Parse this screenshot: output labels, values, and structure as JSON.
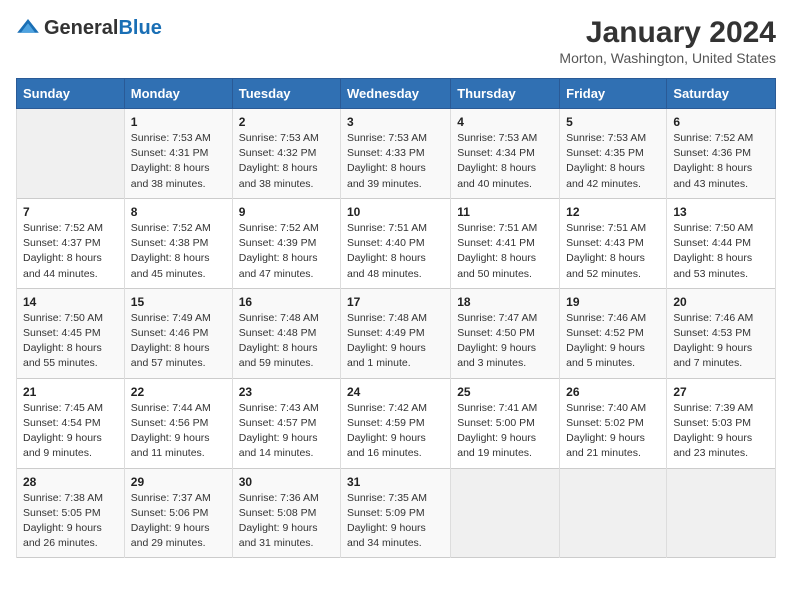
{
  "header": {
    "logo_general": "General",
    "logo_blue": "Blue",
    "month_title": "January 2024",
    "location": "Morton, Washington, United States"
  },
  "days_of_week": [
    "Sunday",
    "Monday",
    "Tuesday",
    "Wednesday",
    "Thursday",
    "Friday",
    "Saturday"
  ],
  "weeks": [
    [
      {
        "day": "",
        "info": ""
      },
      {
        "day": "1",
        "info": "Sunrise: 7:53 AM\nSunset: 4:31 PM\nDaylight: 8 hours\nand 38 minutes."
      },
      {
        "day": "2",
        "info": "Sunrise: 7:53 AM\nSunset: 4:32 PM\nDaylight: 8 hours\nand 38 minutes."
      },
      {
        "day": "3",
        "info": "Sunrise: 7:53 AM\nSunset: 4:33 PM\nDaylight: 8 hours\nand 39 minutes."
      },
      {
        "day": "4",
        "info": "Sunrise: 7:53 AM\nSunset: 4:34 PM\nDaylight: 8 hours\nand 40 minutes."
      },
      {
        "day": "5",
        "info": "Sunrise: 7:53 AM\nSunset: 4:35 PM\nDaylight: 8 hours\nand 42 minutes."
      },
      {
        "day": "6",
        "info": "Sunrise: 7:52 AM\nSunset: 4:36 PM\nDaylight: 8 hours\nand 43 minutes."
      }
    ],
    [
      {
        "day": "7",
        "info": "Sunrise: 7:52 AM\nSunset: 4:37 PM\nDaylight: 8 hours\nand 44 minutes."
      },
      {
        "day": "8",
        "info": "Sunrise: 7:52 AM\nSunset: 4:38 PM\nDaylight: 8 hours\nand 45 minutes."
      },
      {
        "day": "9",
        "info": "Sunrise: 7:52 AM\nSunset: 4:39 PM\nDaylight: 8 hours\nand 47 minutes."
      },
      {
        "day": "10",
        "info": "Sunrise: 7:51 AM\nSunset: 4:40 PM\nDaylight: 8 hours\nand 48 minutes."
      },
      {
        "day": "11",
        "info": "Sunrise: 7:51 AM\nSunset: 4:41 PM\nDaylight: 8 hours\nand 50 minutes."
      },
      {
        "day": "12",
        "info": "Sunrise: 7:51 AM\nSunset: 4:43 PM\nDaylight: 8 hours\nand 52 minutes."
      },
      {
        "day": "13",
        "info": "Sunrise: 7:50 AM\nSunset: 4:44 PM\nDaylight: 8 hours\nand 53 minutes."
      }
    ],
    [
      {
        "day": "14",
        "info": "Sunrise: 7:50 AM\nSunset: 4:45 PM\nDaylight: 8 hours\nand 55 minutes."
      },
      {
        "day": "15",
        "info": "Sunrise: 7:49 AM\nSunset: 4:46 PM\nDaylight: 8 hours\nand 57 minutes."
      },
      {
        "day": "16",
        "info": "Sunrise: 7:48 AM\nSunset: 4:48 PM\nDaylight: 8 hours\nand 59 minutes."
      },
      {
        "day": "17",
        "info": "Sunrise: 7:48 AM\nSunset: 4:49 PM\nDaylight: 9 hours\nand 1 minute."
      },
      {
        "day": "18",
        "info": "Sunrise: 7:47 AM\nSunset: 4:50 PM\nDaylight: 9 hours\nand 3 minutes."
      },
      {
        "day": "19",
        "info": "Sunrise: 7:46 AM\nSunset: 4:52 PM\nDaylight: 9 hours\nand 5 minutes."
      },
      {
        "day": "20",
        "info": "Sunrise: 7:46 AM\nSunset: 4:53 PM\nDaylight: 9 hours\nand 7 minutes."
      }
    ],
    [
      {
        "day": "21",
        "info": "Sunrise: 7:45 AM\nSunset: 4:54 PM\nDaylight: 9 hours\nand 9 minutes."
      },
      {
        "day": "22",
        "info": "Sunrise: 7:44 AM\nSunset: 4:56 PM\nDaylight: 9 hours\nand 11 minutes."
      },
      {
        "day": "23",
        "info": "Sunrise: 7:43 AM\nSunset: 4:57 PM\nDaylight: 9 hours\nand 14 minutes."
      },
      {
        "day": "24",
        "info": "Sunrise: 7:42 AM\nSunset: 4:59 PM\nDaylight: 9 hours\nand 16 minutes."
      },
      {
        "day": "25",
        "info": "Sunrise: 7:41 AM\nSunset: 5:00 PM\nDaylight: 9 hours\nand 19 minutes."
      },
      {
        "day": "26",
        "info": "Sunrise: 7:40 AM\nSunset: 5:02 PM\nDaylight: 9 hours\nand 21 minutes."
      },
      {
        "day": "27",
        "info": "Sunrise: 7:39 AM\nSunset: 5:03 PM\nDaylight: 9 hours\nand 23 minutes."
      }
    ],
    [
      {
        "day": "28",
        "info": "Sunrise: 7:38 AM\nSunset: 5:05 PM\nDaylight: 9 hours\nand 26 minutes."
      },
      {
        "day": "29",
        "info": "Sunrise: 7:37 AM\nSunset: 5:06 PM\nDaylight: 9 hours\nand 29 minutes."
      },
      {
        "day": "30",
        "info": "Sunrise: 7:36 AM\nSunset: 5:08 PM\nDaylight: 9 hours\nand 31 minutes."
      },
      {
        "day": "31",
        "info": "Sunrise: 7:35 AM\nSunset: 5:09 PM\nDaylight: 9 hours\nand 34 minutes."
      },
      {
        "day": "",
        "info": ""
      },
      {
        "day": "",
        "info": ""
      },
      {
        "day": "",
        "info": ""
      }
    ]
  ]
}
